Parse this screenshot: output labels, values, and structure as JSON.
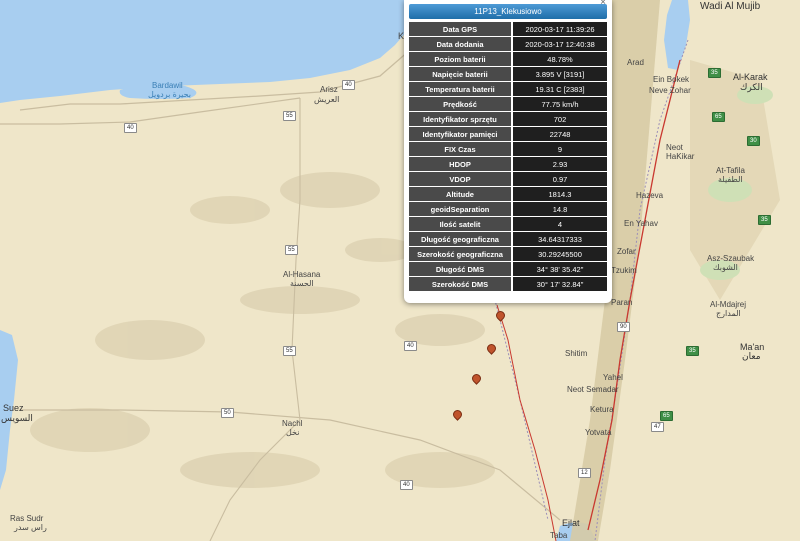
{
  "popup": {
    "title": "11P13_Klekusiowo",
    "close_symbol": "×",
    "rows": [
      {
        "label": "Data GPS",
        "value": "2020-03-17 11:39:26"
      },
      {
        "label": "Data dodania",
        "value": "2020-03-17 12:40:38"
      },
      {
        "label": "Poziom baterii",
        "value": "48.78%"
      },
      {
        "label": "Napięcie baterii",
        "value": "3.895 V [3191]"
      },
      {
        "label": "Temperatura baterii",
        "value": "19.31 C [2383]"
      },
      {
        "label": "Prędkość",
        "value": "77.75 km/h"
      },
      {
        "label": "Identyfikator sprzętu",
        "value": "702"
      },
      {
        "label": "Identyfikator pamięci",
        "value": "22748"
      },
      {
        "label": "FIX Czas",
        "value": "9"
      },
      {
        "label": "HDOP",
        "value": "2.93"
      },
      {
        "label": "VDOP",
        "value": "0.97"
      },
      {
        "label": "Altitude",
        "value": "1814.3"
      },
      {
        "label": "geoidSeparation",
        "value": "14.8"
      },
      {
        "label": "Ilość satelit",
        "value": "4"
      },
      {
        "label": "Długość geograficzna",
        "value": "34.64317333"
      },
      {
        "label": "Szerokość geograficzna",
        "value": "30.29245500"
      },
      {
        "label": "Długość DMS",
        "value": "34° 38' 35.42\""
      },
      {
        "label": "Szerokość DMS",
        "value": "30° 17' 32.84\""
      }
    ]
  },
  "places": {
    "wadi_al_mujib": "Wadi Al Mujib",
    "bardawil": "Bardawil",
    "bardawil_ar": "بحيرة بردويل",
    "arisz": "Arisz",
    "arisz_ar": "العريش",
    "al_hasana": "Al-Hasana",
    "al_hasana_ar": "الحسنة",
    "nachl": "Nachl",
    "nachl_ar": "نخل",
    "suez": "Suez",
    "suez_ar": "السويس",
    "ras_sudr": "Ras Sudr",
    "ras_sudr_ar": "راس سدر",
    "arad": "Arad",
    "ein_bokek": "Ein Bokek",
    "neve_zohar": "Neve Zohar",
    "al_karak": "Al-Karak",
    "al_karak_ar": "الكرك",
    "neot_hakikar": "Neot HaKikar",
    "at_tafila": "At-Tafila",
    "at_tafila_ar": "الطفيلة",
    "hazeva": "Hazeva",
    "en_yahav": "En Yahav",
    "zofar": "Zofar",
    "tzukim": "Tzukim",
    "al_szaubak": "Asz-Szaubak",
    "al_szaubak_ar": "الشوبك",
    "paran": "Paran",
    "al_mdajrej": "Al-Mdajrej",
    "al_mdajrej_ar": "المدارج",
    "shitim": "Shitim",
    "maan": "Ma'an",
    "maan_ar": "معان",
    "neot_semadar": "Neot Semadar",
    "yahel": "Yahel",
    "ketura": "Ketura",
    "yotvata": "Yotvata",
    "ejlat": "Ejlat",
    "taba": "Taba",
    "k_letter": "K"
  },
  "roads": {
    "r40a": "40",
    "r40b": "40",
    "r40c": "40",
    "r40d": "40",
    "r40e": "40",
    "r55a": "55",
    "r55b": "55",
    "r55c": "55",
    "r50": "50",
    "g30": "30",
    "g35a": "35",
    "g35b": "35",
    "g35c": "35",
    "g65a": "65",
    "g65b": "65",
    "g47": "47",
    "s90": "90",
    "s12": "12"
  },
  "colors": {
    "sea": "#a8cef0",
    "land": "#efe6c9",
    "track": "#c9382f",
    "popup_title": "#2e7fbf",
    "row_label": "#4a4a4a",
    "row_value": "#1f1f1f"
  }
}
